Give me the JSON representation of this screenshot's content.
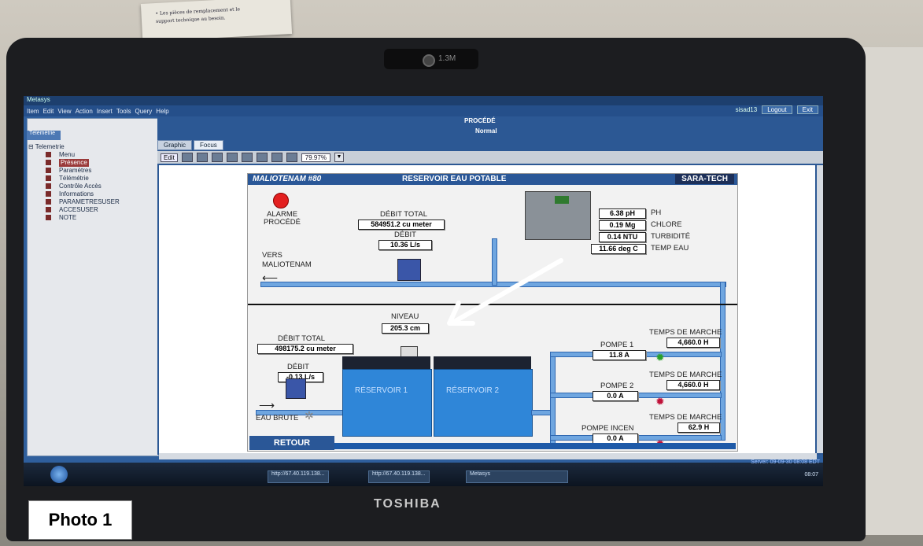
{
  "desk_note": {
    "line1": "• Les pièces de remplacement et le",
    "line2": "support technique au besoin."
  },
  "webcam": {
    "label": "1.3M"
  },
  "laptop": {
    "brand": "TOSHIBA"
  },
  "photo_label": "Photo 1",
  "app": {
    "window_title": "Metasys",
    "menu": [
      "Item",
      "Edit",
      "View",
      "Action",
      "Insert",
      "Tools",
      "Query",
      "Help"
    ],
    "user": "sisad13",
    "logout": "Logout",
    "exit": "Exit"
  },
  "left_panel": {
    "tab": "Télémétrie",
    "root": "Telemetrie",
    "items": [
      "Menu",
      "Présence",
      "Paramètres",
      "Télémétrie",
      "Contrôle Accès",
      "Informations",
      "PARAMETRESUSER",
      "ACCESUSER",
      "NOTE"
    ],
    "selected_index": 1
  },
  "view": {
    "title": "PROCÉDÉ",
    "status": "Normal",
    "tabs": [
      "Graphic",
      "Focus"
    ],
    "edit": "Edit",
    "zoom": "79.97%"
  },
  "hmi": {
    "site": "MALIOTENAM #80",
    "title": "RESERVOIR EAU POTABLE",
    "brand": "SARA-TECH",
    "alarm_label_1": "ALARME",
    "alarm_label_2": "PROCÉDÉ",
    "debit_total_label": "DÉBIT TOTAL",
    "debit_total_value": "584951.2 cu meter",
    "debit_label": "DÉBIT",
    "debit_value": "10.36 L/s",
    "vers_label_1": "VERS",
    "vers_label_2": "MALIOTENAM",
    "analysis": [
      {
        "value": "6.38 pH",
        "label": "PH"
      },
      {
        "value": "0.19 Mg",
        "label": "CHLORE"
      },
      {
        "value": "0.14 NTU",
        "label": "TURBIDITÉ"
      },
      {
        "value": "11.66 deg C",
        "label": "TEMP EAU"
      }
    ],
    "niveau_label": "NIVEAU",
    "niveau_value": "205.3 cm",
    "debit_total_2_label": "DÉBIT TOTAL",
    "debit_total_2_value": "498175.2 cu meter",
    "debit_2_label": "DÉBIT",
    "debit_2_value": "-0.13 L/s",
    "eau_brute": "EAU BRUTE",
    "reservoir_1": "RÉSERVOIR 1",
    "reservoir_2": "RÉSERVOIR 2",
    "pumps": [
      {
        "name": "POMPE 1",
        "current": "11.8 A",
        "run_label": "TEMPS DE MARCHE",
        "run_time": "4,660.0 H",
        "status_color": "#2aa02a"
      },
      {
        "name": "POMPE 2",
        "current": "0.0 A",
        "run_label": "TEMPS DE MARCHE",
        "run_time": "4,660.0 H",
        "status_color": "#c0123a"
      },
      {
        "name": "POMPE INCEN",
        "current": "0.0 A",
        "run_label": "TEMPS DE MARCHE",
        "run_time": "62.9 H",
        "status_color": "#c0123a"
      }
    ],
    "retour": "RETOUR"
  },
  "taskbar": {
    "items": [
      "http://67.40.119.138...",
      "http://67.40.119.138...",
      "Metasys"
    ],
    "server_time": "Server: 09-09-30 08:08 EDT",
    "clock": "08:07"
  }
}
